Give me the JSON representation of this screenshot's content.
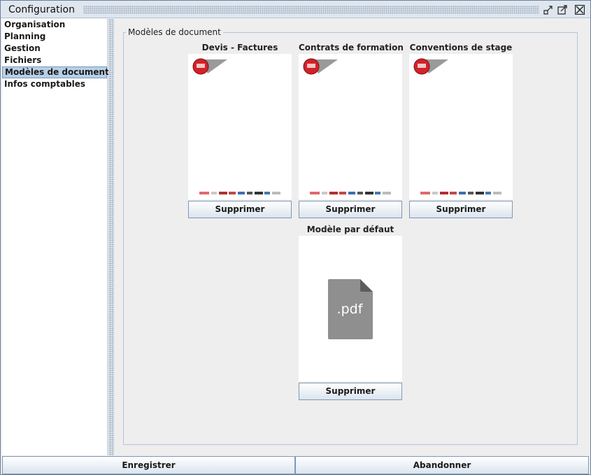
{
  "window": {
    "title": "Configuration",
    "controls": [
      "minimize-icon",
      "maximize-icon",
      "close-icon"
    ]
  },
  "nav": {
    "items": [
      {
        "label": "Organisation",
        "selected": false
      },
      {
        "label": "Planning",
        "selected": false
      },
      {
        "label": "Gestion",
        "selected": false
      },
      {
        "label": "Fichiers",
        "selected": false
      },
      {
        "label": "Modèles de document",
        "selected": true
      },
      {
        "label": "Infos comptables",
        "selected": false
      }
    ]
  },
  "main": {
    "group_title": "Modèles de document",
    "templates": [
      {
        "title": "Devis - Factures",
        "delete_label": "Supprimer",
        "preview": "letterhead"
      },
      {
        "title": "Contrats de formation",
        "delete_label": "Supprimer",
        "preview": "letterhead"
      },
      {
        "title": "Conventions de stage",
        "delete_label": "Supprimer",
        "preview": "letterhead"
      },
      {
        "title": "Modèle par défaut",
        "delete_label": "Supprimer",
        "preview": "pdf-file-icon",
        "icon_text": ".pdf"
      }
    ]
  },
  "footer": {
    "save_label": "Enregistrer",
    "cancel_label": "Abandonner"
  },
  "colors": {
    "accent_selection": "#b8cfe5",
    "logo_red": "#d42128",
    "pdf_gray": "#8f8f8f"
  }
}
